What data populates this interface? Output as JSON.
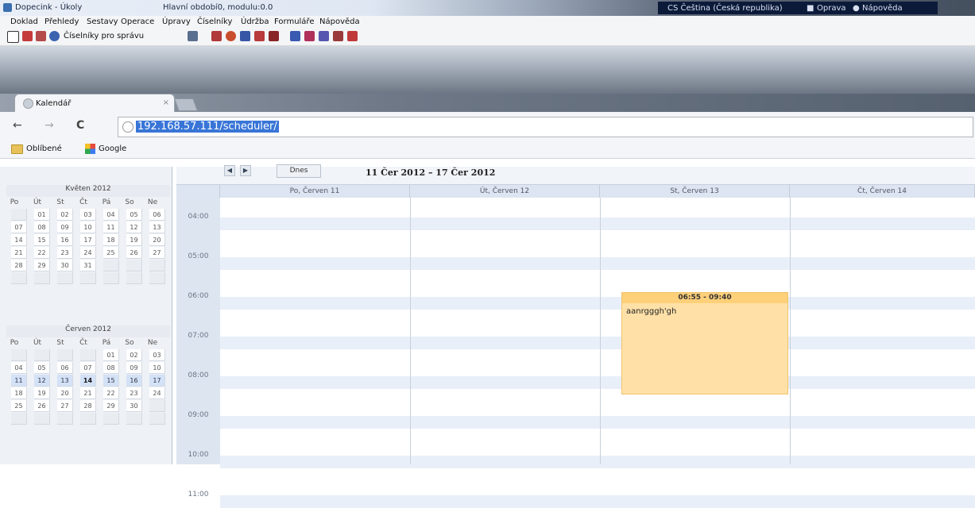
{
  "window": {
    "app_title": "Dopecink - Úkoly",
    "module_title": "Hlavní období0, modulu:0.0",
    "language": "CS Čeština (Česká republika)",
    "oprava": "Oprava",
    "napoveda": "Nápověda"
  },
  "menu": [
    "Doklad",
    "Přehledy",
    "Sestavy",
    "Operace",
    "Úpravy",
    "Číselníky",
    "Údržba",
    "Formuláře",
    "Nápověda"
  ],
  "toolbar": {
    "ciselniky_label": "Číselníky pro správu"
  },
  "browser": {
    "tab_title": "Kalendář",
    "url": "192.168.57.111/scheduler/",
    "bookmarks": [
      "Oblíbené",
      "Google"
    ]
  },
  "mini_calendars": [
    {
      "title": "Květen 2012",
      "dow": [
        "Po",
        "Út",
        "St",
        "Čt",
        "Pá",
        "So",
        "Ne"
      ],
      "weeks": [
        [
          "",
          "01",
          "02",
          "03",
          "04",
          "05",
          "06"
        ],
        [
          "07",
          "08",
          "09",
          "10",
          "11",
          "12",
          "13"
        ],
        [
          "14",
          "15",
          "16",
          "17",
          "18",
          "19",
          "20"
        ],
        [
          "21",
          "22",
          "23",
          "24",
          "25",
          "26",
          "27"
        ],
        [
          "28",
          "29",
          "30",
          "31",
          "",
          "",
          ""
        ],
        [
          "",
          "",
          "",
          "",
          "",
          "",
          ""
        ]
      ]
    },
    {
      "title": "Červen 2012",
      "dow": [
        "Po",
        "Út",
        "St",
        "Čt",
        "Pá",
        "So",
        "Ne"
      ],
      "weeks": [
        [
          "",
          "",
          "",
          "",
          "01",
          "02",
          "03"
        ],
        [
          "04",
          "05",
          "06",
          "07",
          "08",
          "09",
          "10"
        ],
        [
          "11",
          "12",
          "13",
          "14",
          "15",
          "16",
          "17"
        ],
        [
          "18",
          "19",
          "20",
          "21",
          "22",
          "23",
          "24"
        ],
        [
          "25",
          "26",
          "27",
          "28",
          "29",
          "30",
          ""
        ],
        [
          "",
          "",
          "",
          "",
          "",
          "",
          ""
        ]
      ],
      "highlight_week": 2,
      "today": "14"
    }
  ],
  "scheduler": {
    "today_label": "Dnes",
    "range": "11 Čer 2012 – 17 Čer 2012",
    "days": [
      "Po, Červen 11",
      "Út, Červen 12",
      "St, Červen 13",
      "Čt, Červen 14"
    ],
    "hours": [
      "04:00",
      "05:00",
      "06:00",
      "07:00",
      "08:00",
      "09:00",
      "10:00",
      "11:00"
    ],
    "event": {
      "time": "06:55 - 09:40",
      "text": "aanrgggh'gh"
    }
  }
}
